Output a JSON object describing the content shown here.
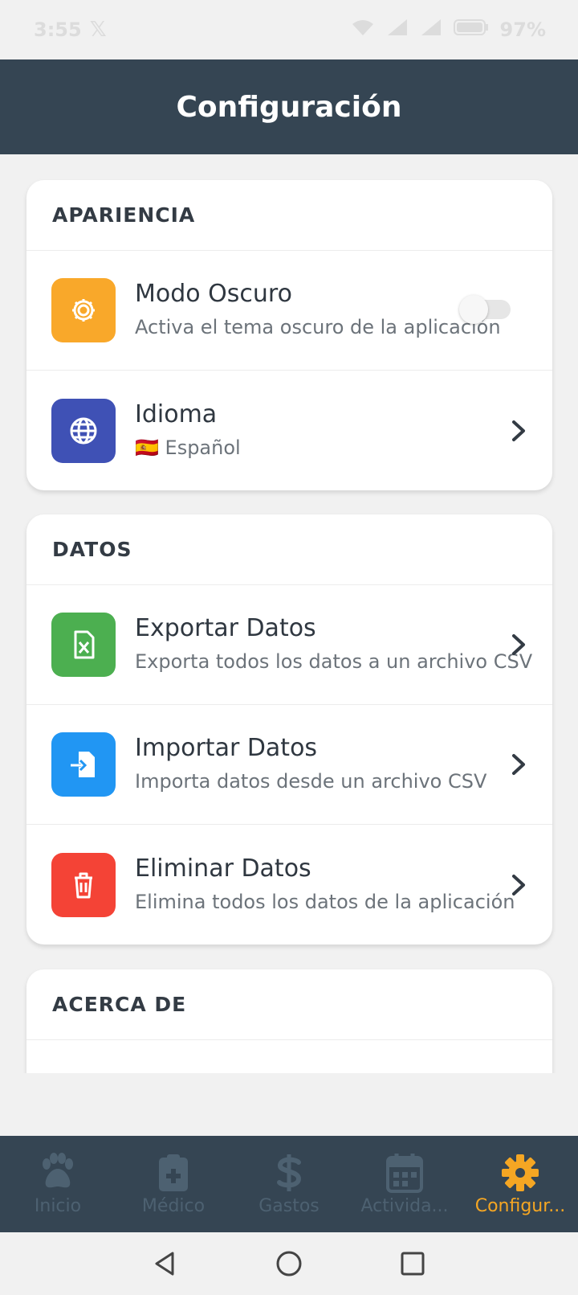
{
  "status_bar": {
    "time": "3:55",
    "battery": "97%"
  },
  "header": {
    "title": "Configuración"
  },
  "sections": {
    "appearance": {
      "title": "APARIENCIA",
      "dark_mode": {
        "title": "Modo Oscuro",
        "subtitle": "Activa el tema oscuro de la aplicación",
        "enabled": false
      },
      "language": {
        "title": "Idioma",
        "value": "Español",
        "flag": "🇪🇸"
      }
    },
    "data": {
      "title": "DATOS",
      "export": {
        "title": "Exportar Datos",
        "subtitle": "Exporta todos los datos a un archivo CSV"
      },
      "import": {
        "title": "Importar Datos",
        "subtitle": "Importa datos desde un archivo CSV"
      },
      "delete": {
        "title": "Eliminar Datos",
        "subtitle": "Elimina todos los datos de la aplicación"
      }
    },
    "about": {
      "title": "ACERCA DE"
    }
  },
  "bottom_nav": {
    "items": [
      {
        "label": "Inicio",
        "icon": "paw-icon"
      },
      {
        "label": "Médico",
        "icon": "medical-clipboard-icon"
      },
      {
        "label": "Gastos",
        "icon": "dollar-icon"
      },
      {
        "label": "Activida...",
        "icon": "calendar-icon"
      },
      {
        "label": "Configur...",
        "icon": "gear-icon"
      }
    ],
    "active_index": 4
  },
  "colors": {
    "header_bg": "#354553",
    "accent": "#f5a623",
    "dark_mode_icon": "#f9a82a",
    "language_icon": "#3f51b5",
    "export_icon": "#4caf50",
    "import_icon": "#2196f3",
    "delete_icon": "#f44336"
  }
}
